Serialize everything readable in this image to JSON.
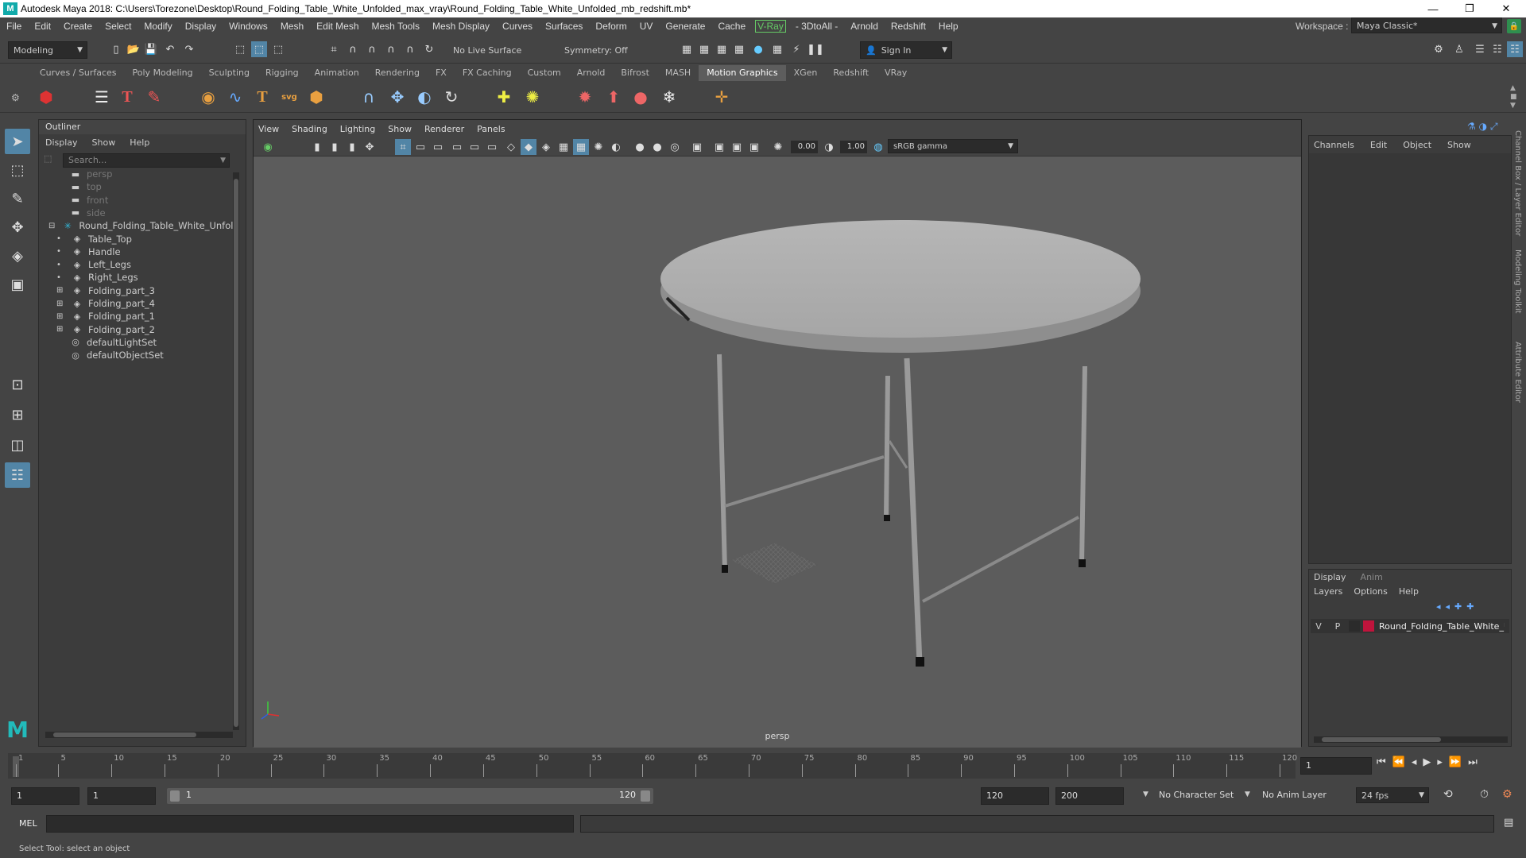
{
  "title": "Autodesk Maya 2018: C:\\Users\\Torezone\\Desktop\\Round_Folding_Table_White_Unfolded_max_vray\\Round_Folding_Table_White_Unfolded_mb_redshift.mb*",
  "menubar": [
    "File",
    "Edit",
    "Create",
    "Select",
    "Modify",
    "Display",
    "Windows",
    "Mesh",
    "Edit Mesh",
    "Mesh Tools",
    "Mesh Display",
    "Curves",
    "Surfaces",
    "Deform",
    "UV",
    "Generate",
    "Cache"
  ],
  "menubar_vray": "V-Ray",
  "menubar_after": [
    "- 3DtoAll -",
    "Arnold",
    "Redshift",
    "Help"
  ],
  "workspace_label": "Workspace :",
  "workspace_value": "Maya Classic*",
  "mode_value": "Modeling",
  "live_surface": "No Live Surface",
  "symmetry": "Symmetry: Off",
  "sign_in": "Sign In",
  "shelf_tabs": [
    "Curves / Surfaces",
    "Poly Modeling",
    "Sculpting",
    "Rigging",
    "Animation",
    "Rendering",
    "FX",
    "FX Caching",
    "Custom",
    "Arnold",
    "Bifrost",
    "MASH",
    "Motion Graphics",
    "XGen",
    "Redshift",
    "VRay"
  ],
  "shelf_active": "Motion Graphics",
  "outliner": {
    "title": "Outliner",
    "menus": [
      "Display",
      "Show",
      "Help"
    ],
    "search_placeholder": "Search...",
    "items": [
      {
        "label": "persp",
        "type": "camera",
        "indent": 0,
        "dim": true
      },
      {
        "label": "top",
        "type": "camera",
        "indent": 0,
        "dim": true
      },
      {
        "label": "front",
        "type": "camera",
        "indent": 0,
        "dim": true
      },
      {
        "label": "side",
        "type": "camera",
        "indent": 0,
        "dim": true
      },
      {
        "label": "Round_Folding_Table_White_Unfold",
        "type": "group",
        "indent": 0,
        "dim": false
      },
      {
        "label": "Table_Top",
        "type": "mesh",
        "indent": 1,
        "dim": false
      },
      {
        "label": "Handle",
        "type": "mesh",
        "indent": 1,
        "dim": false
      },
      {
        "label": "Left_Legs",
        "type": "mesh",
        "indent": 1,
        "dim": false
      },
      {
        "label": "Right_Legs",
        "type": "mesh",
        "indent": 1,
        "dim": false
      },
      {
        "label": "Folding_part_3",
        "type": "mesh",
        "indent": 1,
        "dim": false
      },
      {
        "label": "Folding_part_4",
        "type": "mesh",
        "indent": 1,
        "dim": false
      },
      {
        "label": "Folding_part_1",
        "type": "mesh",
        "indent": 1,
        "dim": false
      },
      {
        "label": "Folding_part_2",
        "type": "mesh",
        "indent": 1,
        "dim": false
      },
      {
        "label": "defaultLightSet",
        "type": "set",
        "indent": 0,
        "dim": false
      },
      {
        "label": "defaultObjectSet",
        "type": "set",
        "indent": 0,
        "dim": false
      }
    ]
  },
  "viewport": {
    "menus": [
      "View",
      "Shading",
      "Lighting",
      "Show",
      "Renderer",
      "Panels"
    ],
    "exposure": "0.00",
    "gamma": "1.00",
    "color_space": "sRGB gamma",
    "camera_label": "persp"
  },
  "channel_box": {
    "menus": [
      "Channels",
      "Edit",
      "Object",
      "Show"
    ]
  },
  "layer_editor": {
    "tabs": [
      "Display",
      "Anim"
    ],
    "menus": [
      "Layers",
      "Options",
      "Help"
    ],
    "layer_v": "V",
    "layer_p": "P",
    "layer_name": "Round_Folding_Table_White_Unfolded",
    "layer_color": "#c0143c"
  },
  "side_tabs": [
    "Channel Box / Layer Editor",
    "Modeling Toolkit",
    "Attribute Editor"
  ],
  "timeline": {
    "ticks": [
      "1",
      "5",
      "10",
      "15",
      "20",
      "25",
      "30",
      "35",
      "40",
      "45",
      "50",
      "55",
      "60",
      "65",
      "70",
      "75",
      "80",
      "85",
      "90",
      "95",
      "100",
      "105",
      "110",
      "115",
      "120"
    ],
    "current_frame": "1"
  },
  "range": {
    "start": "1",
    "anim_start": "1",
    "slider_start": "1",
    "slider_end": "120",
    "anim_end": "120",
    "end": "200",
    "character_set": "No Character Set",
    "anim_layer": "No Anim Layer",
    "fps": "24 fps"
  },
  "cmd_label": "MEL",
  "help_text": "Select Tool: select an object"
}
